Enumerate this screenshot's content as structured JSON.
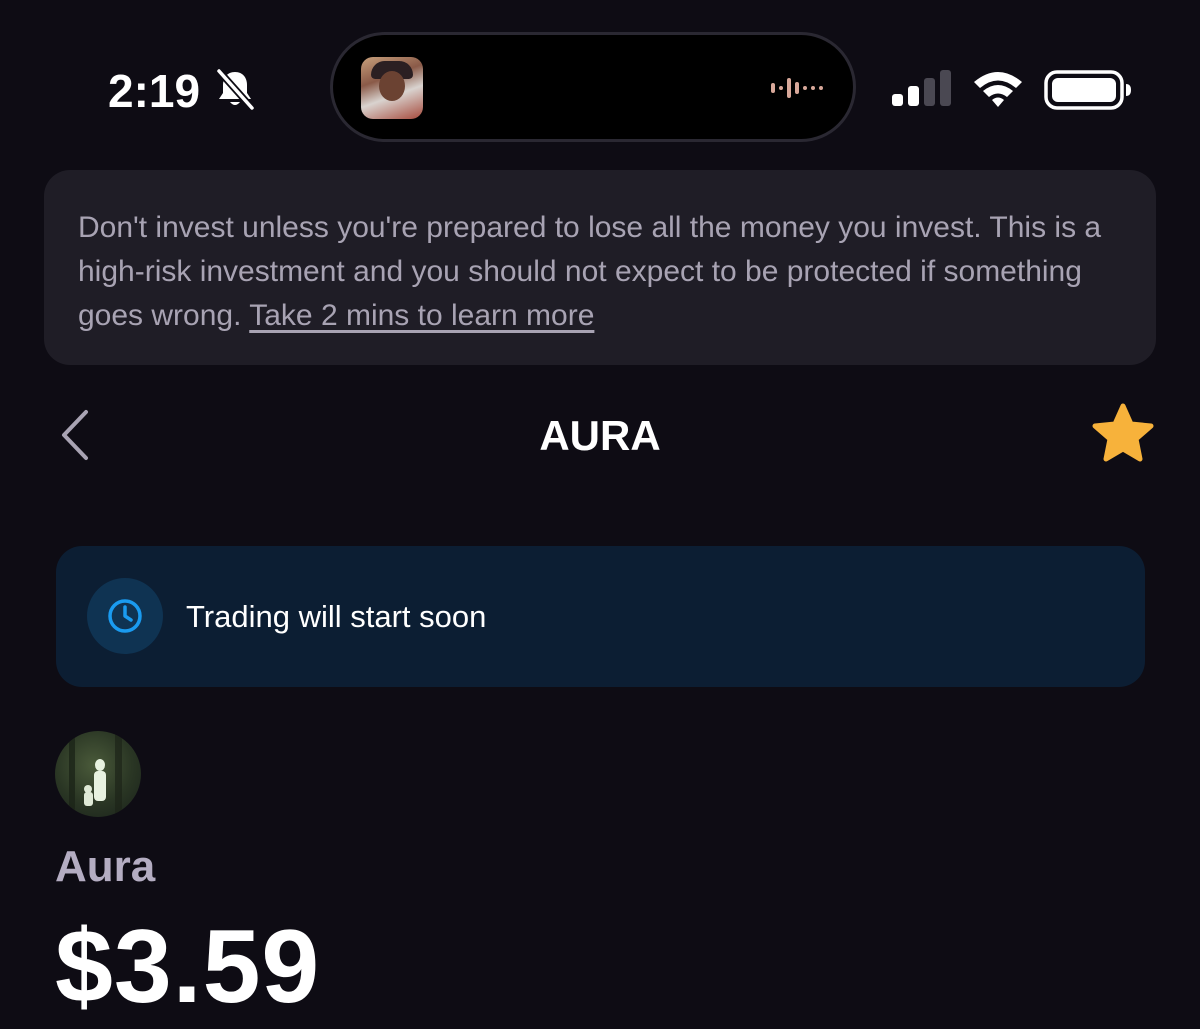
{
  "status_bar": {
    "time": "2:19",
    "battery_level": 0.95,
    "signal_bars": 2,
    "icons": [
      "bell-slash-icon",
      "waveform-icon",
      "signal-icon",
      "wifi-icon",
      "battery-icon"
    ]
  },
  "warning": {
    "text": "Don't invest unless you're prepared to lose all the money you invest. This is a high-risk investment and you should not expect to be protected if something goes wrong. ",
    "link": "Take 2 mins to learn more"
  },
  "nav": {
    "title": "AURA",
    "back_icon": "chevron-left-icon",
    "favorite_icon": "star-icon"
  },
  "trading_notice": {
    "text": "Trading will start soon",
    "icon": "clock-icon"
  },
  "token": {
    "name": "Aura",
    "price": "$3.59"
  },
  "colors": {
    "background": "#0e0c14",
    "banner_bg": "#1f1d26",
    "notice_bg": "#0c1e33",
    "accent_blue": "#1a9bf0",
    "star": "#f7b23b",
    "muted_text": "#a8a3b3"
  }
}
